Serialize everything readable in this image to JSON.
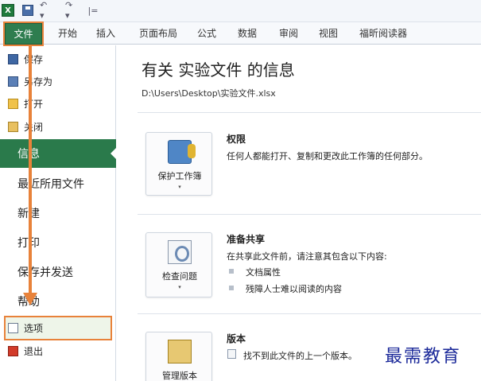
{
  "quick_access": {
    "logo_text": "X",
    "undo_glyph": "↶ ▾",
    "redo_glyph": "↷ ▾",
    "customize_glyph": "|="
  },
  "ribbon": {
    "file_tab": "文件",
    "tabs": [
      "开始",
      "插入",
      "页面布局",
      "公式",
      "数据",
      "审阅",
      "视图",
      "福昕阅读器"
    ]
  },
  "backstage_nav": {
    "save": "保存",
    "save_as": "另存为",
    "open": "打开",
    "close": "关闭",
    "info": "信息",
    "recent": "最近所用文件",
    "new": "新建",
    "print": "打印",
    "save_send": "保存并发送",
    "help": "帮助",
    "options": "选项",
    "exit": "退出"
  },
  "info_panel": {
    "title": "有关 实验文件 的信息",
    "path": "D:\\Users\\Desktop\\实验文件.xlsx",
    "permissions": {
      "button_label": "保护工作簿",
      "title": "权限",
      "description": "任何人都能打开、复制和更改此工作簿的任何部分。"
    },
    "prepare_sharing": {
      "button_label": "检查问题",
      "title": "准备共享",
      "description": "在共享此文件前，请注意其包含以下内容:",
      "items": [
        "文档属性",
        "残障人士难以阅读的内容"
      ]
    },
    "versions": {
      "button_label": "管理版本",
      "title": "版本",
      "description": "找不到此文件的上一个版本。"
    }
  },
  "dropdown_caret": "▾",
  "watermark": "最需教育",
  "colors": {
    "file_tab_green": "#2e7d4f",
    "info_selected_green": "#2a7a4b",
    "highlight_orange": "#e8823a",
    "watermark_blue": "#1c2a9a"
  }
}
